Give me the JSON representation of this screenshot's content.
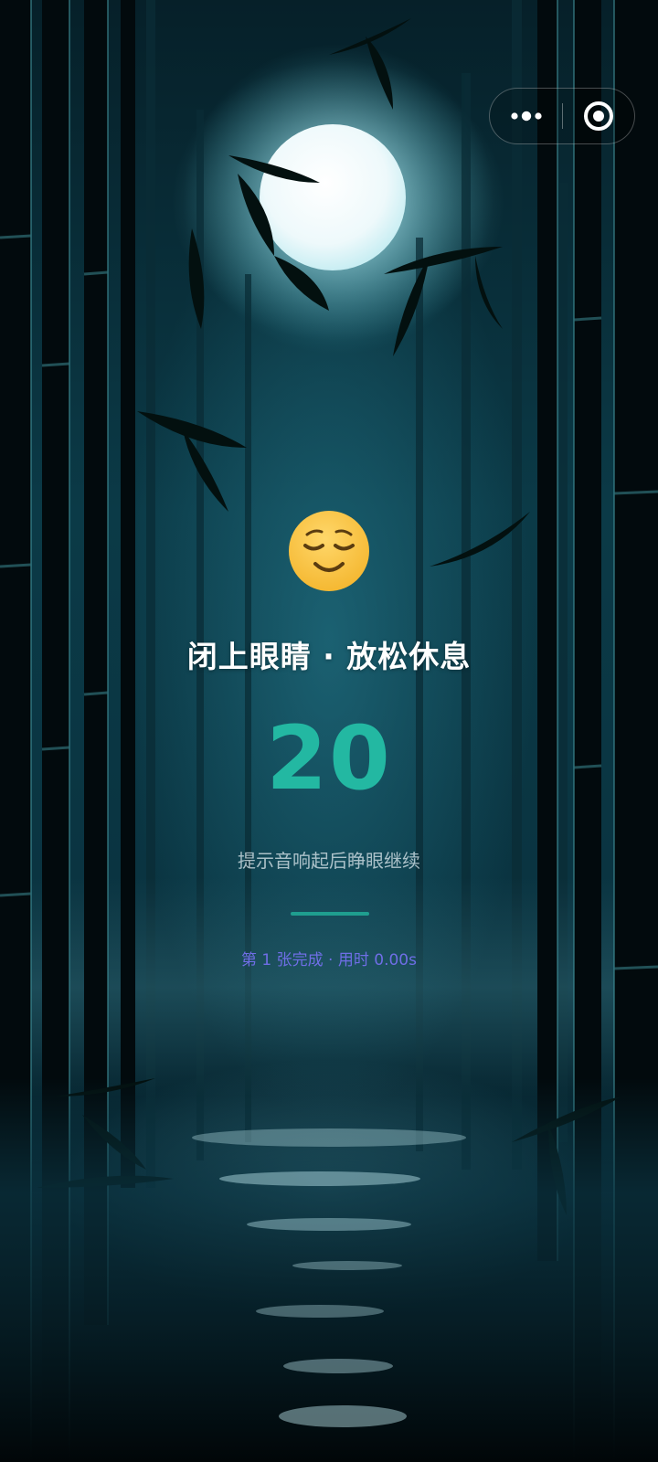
{
  "capsule": {
    "more_icon": "more-dots-icon",
    "close_icon": "target-circle-icon"
  },
  "rest": {
    "emoji_icon": "relieved-face-icon",
    "title": "闭上眼睛 · 放松休息",
    "countdown": "20",
    "hint": "提示音响起后睁眼继续",
    "progress": "第 1 张完成 · 用时 0.00s"
  },
  "colors": {
    "accent": "#23b8a2",
    "progress_text": "#6f6ee6",
    "divider": "#1f9e8f"
  }
}
